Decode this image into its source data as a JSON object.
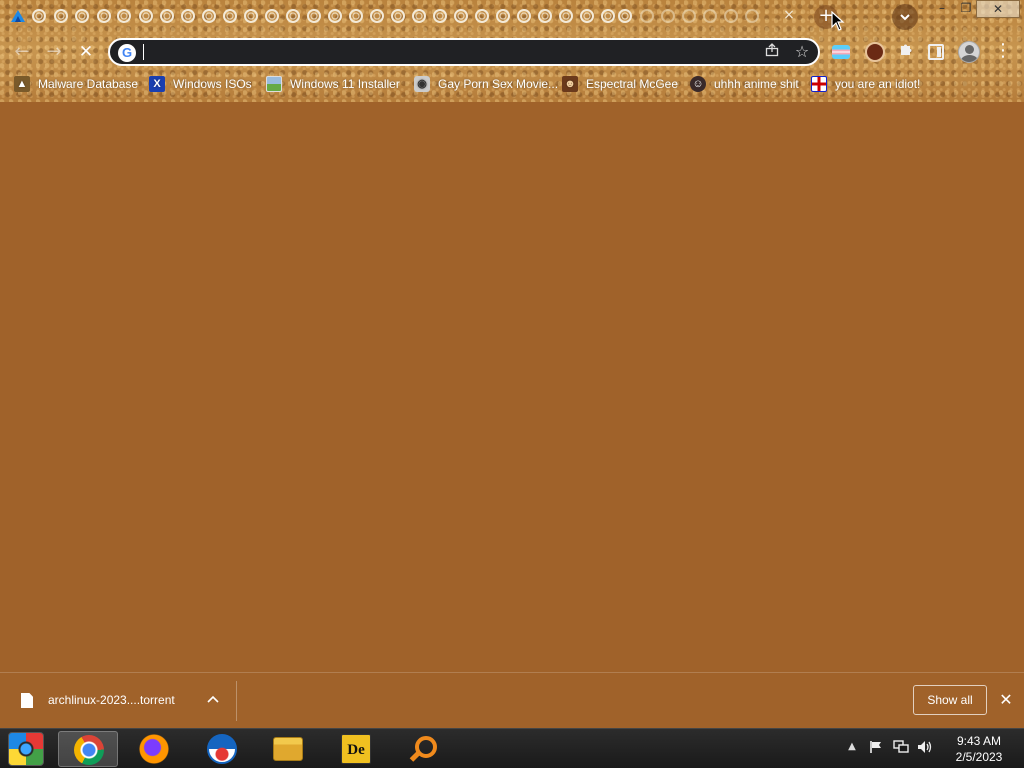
{
  "browser": {
    "tab_strip": {
      "tab_count_icons": 29,
      "close_glyph": "×",
      "new_tab_glyph": "+",
      "tab_search_glyph": "⌄"
    },
    "window_controls": {
      "minimize": "–",
      "maximize": "❐",
      "close": "✕"
    },
    "toolbar": {
      "back_glyph": "←",
      "forward_glyph": "→",
      "reload_glyph": "✕",
      "omnibox": {
        "value": "",
        "placeholder": "",
        "engine_icon_glyph": "G"
      },
      "share_glyph": "⇪",
      "star_glyph": "☆",
      "extensions_glyph": "✱",
      "menu_glyph": "⋮"
    },
    "bookmarks": [
      {
        "label": "Malware Database",
        "icon": "mountain-icon"
      },
      {
        "label": "Windows ISOs",
        "icon": "x-icon"
      },
      {
        "label": "Windows 11 Installer",
        "icon": "image-icon"
      },
      {
        "label": "Gay Porn Sex Movie...",
        "icon": "disc-icon"
      },
      {
        "label": "Espectral McGee",
        "icon": "character-icon"
      },
      {
        "label": "uhhh anime shit",
        "icon": "anime-icon"
      },
      {
        "label": "you are an idiot!",
        "icon": "flag-icon"
      }
    ]
  },
  "downloads": {
    "item_name": "archlinux-2023....torrent",
    "chevron_glyph": "^",
    "show_all_label": "Show all",
    "close_glyph": "✕"
  },
  "taskbar": {
    "apps": [
      "start",
      "chrome",
      "firefox",
      "obama",
      "file-explorer",
      "de-app",
      "search"
    ],
    "active_app": "chrome",
    "tray": {
      "chevron_glyph": "▲"
    },
    "clock": {
      "time": "9:43 AM",
      "date": "2/5/2023"
    }
  },
  "colors": {
    "content_bg": "#a0622a",
    "omnibox_bg": "#202124",
    "taskbar_bg": "#1a1a1a"
  }
}
